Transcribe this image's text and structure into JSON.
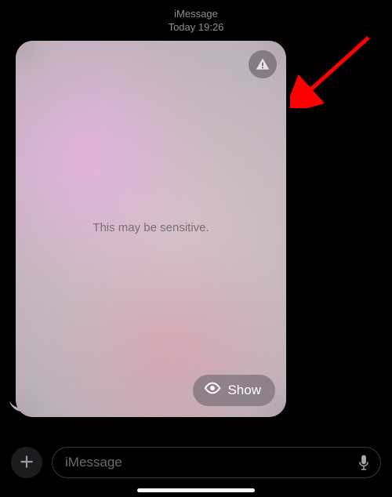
{
  "header": {
    "service": "iMessage",
    "timestamp": "Today 19:26"
  },
  "message": {
    "sensitive_label": "This may be sensitive.",
    "show_button_label": "Show"
  },
  "composer": {
    "placeholder": "iMessage"
  },
  "annotation": {
    "arrow_color": "#ff0000"
  }
}
